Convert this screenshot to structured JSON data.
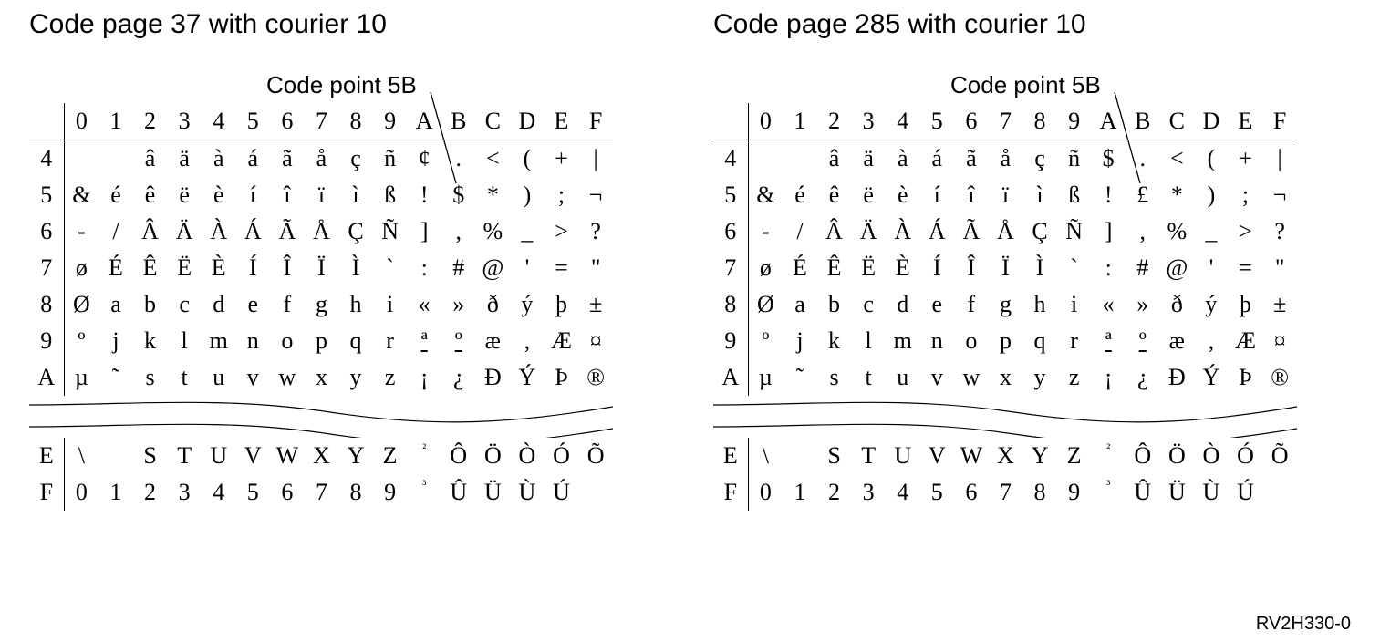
{
  "footer_id": "RV2H330-0",
  "panels": [
    {
      "title": "Code page 37 with courier 10",
      "callout": "Code point 5B",
      "col_headers": [
        "0",
        "1",
        "2",
        "3",
        "4",
        "5",
        "6",
        "7",
        "8",
        "9",
        "A",
        "B",
        "C",
        "D",
        "E",
        "F"
      ],
      "rows": [
        {
          "stub": "4",
          "cells": [
            "",
            "",
            "â",
            "ä",
            "à",
            "á",
            "ã",
            "å",
            "ç",
            "ñ",
            "¢",
            ".",
            "<",
            "(",
            "+",
            "|"
          ]
        },
        {
          "stub": "5",
          "cells": [
            "&",
            "é",
            "ê",
            "ë",
            "è",
            "í",
            "î",
            "ï",
            "ì",
            "ß",
            "!",
            "$",
            "*",
            ")",
            ";",
            "¬"
          ]
        },
        {
          "stub": "6",
          "cells": [
            "-",
            "/",
            "Â",
            "Ä",
            "À",
            "Á",
            "Ã",
            "Å",
            "Ç",
            "Ñ",
            "]",
            ",",
            "%",
            "_",
            ">",
            "?"
          ]
        },
        {
          "stub": "7",
          "cells": [
            "ø",
            "É",
            "Ê",
            "Ë",
            "È",
            "Í",
            "Î",
            "Ï",
            "Ì",
            "`",
            ":",
            "#",
            "@",
            "'",
            "=",
            "\""
          ]
        },
        {
          "stub": "8",
          "cells": [
            "Ø",
            "a",
            "b",
            "c",
            "d",
            "e",
            "f",
            "g",
            "h",
            "i",
            "«",
            "»",
            "ð",
            "ý",
            "þ",
            "±"
          ]
        },
        {
          "stub": "9",
          "cells": [
            "º",
            "j",
            "k",
            "l",
            "m",
            "n",
            "o",
            "p",
            "q",
            "r",
            "ª",
            "º",
            "æ",
            ",",
            "Æ",
            "¤"
          ]
        },
        {
          "stub": "A",
          "cells": [
            "µ",
            "˜",
            "s",
            "t",
            "u",
            "v",
            "w",
            "x",
            "y",
            "z",
            "¡",
            "¿",
            "Ð",
            "Ý",
            "Þ",
            "®"
          ]
        }
      ],
      "rows_after_gap": [
        {
          "stub": "E",
          "cells": [
            "\\",
            "",
            "S",
            "T",
            "U",
            "V",
            "W",
            "X",
            "Y",
            "Z",
            "²",
            "Ô",
            "Ö",
            "Ò",
            "Ó",
            "Õ"
          ]
        },
        {
          "stub": "F",
          "cells": [
            "0",
            "1",
            "2",
            "3",
            "4",
            "5",
            "6",
            "7",
            "8",
            "9",
            "³",
            "Û",
            "Ü",
            "Ù",
            "Ú",
            ""
          ]
        }
      ]
    },
    {
      "title": "Code page 285 with courier 10",
      "callout": "Code point 5B",
      "col_headers": [
        "0",
        "1",
        "2",
        "3",
        "4",
        "5",
        "6",
        "7",
        "8",
        "9",
        "A",
        "B",
        "C",
        "D",
        "E",
        "F"
      ],
      "rows": [
        {
          "stub": "4",
          "cells": [
            "",
            "",
            "â",
            "ä",
            "à",
            "á",
            "ã",
            "å",
            "ç",
            "ñ",
            "$",
            ".",
            "<",
            "(",
            "+",
            "|"
          ]
        },
        {
          "stub": "5",
          "cells": [
            "&",
            "é",
            "ê",
            "ë",
            "è",
            "í",
            "î",
            "ï",
            "ì",
            "ß",
            "!",
            "£",
            "*",
            ")",
            ";",
            "¬"
          ]
        },
        {
          "stub": "6",
          "cells": [
            "-",
            "/",
            "Â",
            "Ä",
            "À",
            "Á",
            "Ã",
            "Å",
            "Ç",
            "Ñ",
            "]",
            ",",
            "%",
            "_",
            ">",
            "?"
          ]
        },
        {
          "stub": "7",
          "cells": [
            "ø",
            "É",
            "Ê",
            "Ë",
            "È",
            "Í",
            "Î",
            "Ï",
            "Ì",
            "`",
            ":",
            "#",
            "@",
            "'",
            "=",
            "\""
          ]
        },
        {
          "stub": "8",
          "cells": [
            "Ø",
            "a",
            "b",
            "c",
            "d",
            "e",
            "f",
            "g",
            "h",
            "i",
            "«",
            "»",
            "ð",
            "ý",
            "þ",
            "±"
          ]
        },
        {
          "stub": "9",
          "cells": [
            "º",
            "j",
            "k",
            "l",
            "m",
            "n",
            "o",
            "p",
            "q",
            "r",
            "ª",
            "º",
            "æ",
            ",",
            "Æ",
            "¤"
          ]
        },
        {
          "stub": "A",
          "cells": [
            "µ",
            "˜",
            "s",
            "t",
            "u",
            "v",
            "w",
            "x",
            "y",
            "z",
            "¡",
            "¿",
            "Ð",
            "Ý",
            "Þ",
            "®"
          ]
        }
      ],
      "rows_after_gap": [
        {
          "stub": "E",
          "cells": [
            "\\",
            "",
            "S",
            "T",
            "U",
            "V",
            "W",
            "X",
            "Y",
            "Z",
            "²",
            "Ô",
            "Ö",
            "Ò",
            "Ó",
            "Õ"
          ]
        },
        {
          "stub": "F",
          "cells": [
            "0",
            "1",
            "2",
            "3",
            "4",
            "5",
            "6",
            "7",
            "8",
            "9",
            "³",
            "Û",
            "Ü",
            "Ù",
            "Ú",
            ""
          ]
        }
      ]
    }
  ]
}
